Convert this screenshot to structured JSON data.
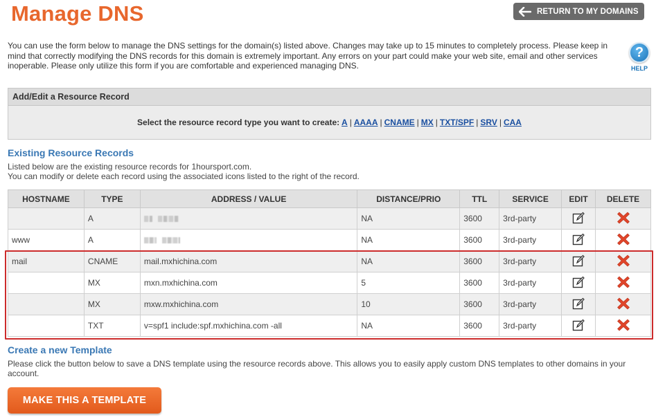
{
  "header": {
    "title": "Manage DNS",
    "return_label": "RETURN TO MY DOMAINS"
  },
  "intro": {
    "text": "You can use the form below to manage the DNS settings for the domain(s) listed above. Changes may take up to 15 minutes to completely process. Please keep in mind that correctly modifying the DNS records for this domain is extremely important. Any errors on your part could make your web site, email and other services inoperable. Please only utilize this form if you are comfortable and experienced managing DNS."
  },
  "help": {
    "label": "HELP",
    "icon": "help-icon"
  },
  "add_edit": {
    "heading": "Add/Edit a Resource Record",
    "prompt": "Select the resource record type you want to create:",
    "types": [
      "A",
      "AAAA",
      "CNAME",
      "MX",
      "TXT/SPF",
      "SRV",
      "CAA"
    ]
  },
  "existing": {
    "title": "Existing Resource Records",
    "desc_line1": "Listed below are the existing resource records for 1hoursport.com.",
    "desc_line2": "You can modify or delete each record using the associated icons listed to the right of the record.",
    "columns": {
      "hostname": "HOSTNAME",
      "type": "TYPE",
      "address": "ADDRESS / VALUE",
      "distance": "DISTANCE/PRIO",
      "ttl": "TTL",
      "service": "SERVICE",
      "edit": "EDIT",
      "delete": "DELETE"
    },
    "rows": [
      {
        "hostname": "",
        "type": "A",
        "address": "",
        "address_redacted": true,
        "distance": "NA",
        "ttl": "3600",
        "service": "3rd-party"
      },
      {
        "hostname": "www",
        "type": "A",
        "address": "",
        "address_redacted": true,
        "distance": "NA",
        "ttl": "3600",
        "service": "3rd-party"
      },
      {
        "hostname": "mail",
        "type": "CNAME",
        "address": "mail.mxhichina.com",
        "address_redacted": false,
        "distance": "NA",
        "ttl": "3600",
        "service": "3rd-party"
      },
      {
        "hostname": "",
        "type": "MX",
        "address": "mxn.mxhichina.com",
        "address_redacted": false,
        "distance": "5",
        "ttl": "3600",
        "service": "3rd-party"
      },
      {
        "hostname": "",
        "type": "MX",
        "address": "mxw.mxhichina.com",
        "address_redacted": false,
        "distance": "10",
        "ttl": "3600",
        "service": "3rd-party"
      },
      {
        "hostname": "",
        "type": "TXT",
        "address": "v=spf1 include:spf.mxhichina.com -all",
        "address_redacted": false,
        "distance": "NA",
        "ttl": "3600",
        "service": "3rd-party"
      }
    ]
  },
  "template": {
    "title": "Create a new Template",
    "desc": "Please click the button below to save a DNS template using the resource records above. This allows you to easily apply custom DNS templates to other domains in your account.",
    "button_label": "MAKE THIS A TEMPLATE"
  },
  "colors": {
    "brand_orange": "#e8672d",
    "link_blue": "#1a4fa0",
    "section_blue": "#3a78b4",
    "highlight_red": "#cc2b2b",
    "delete_red": "#e0452a"
  }
}
